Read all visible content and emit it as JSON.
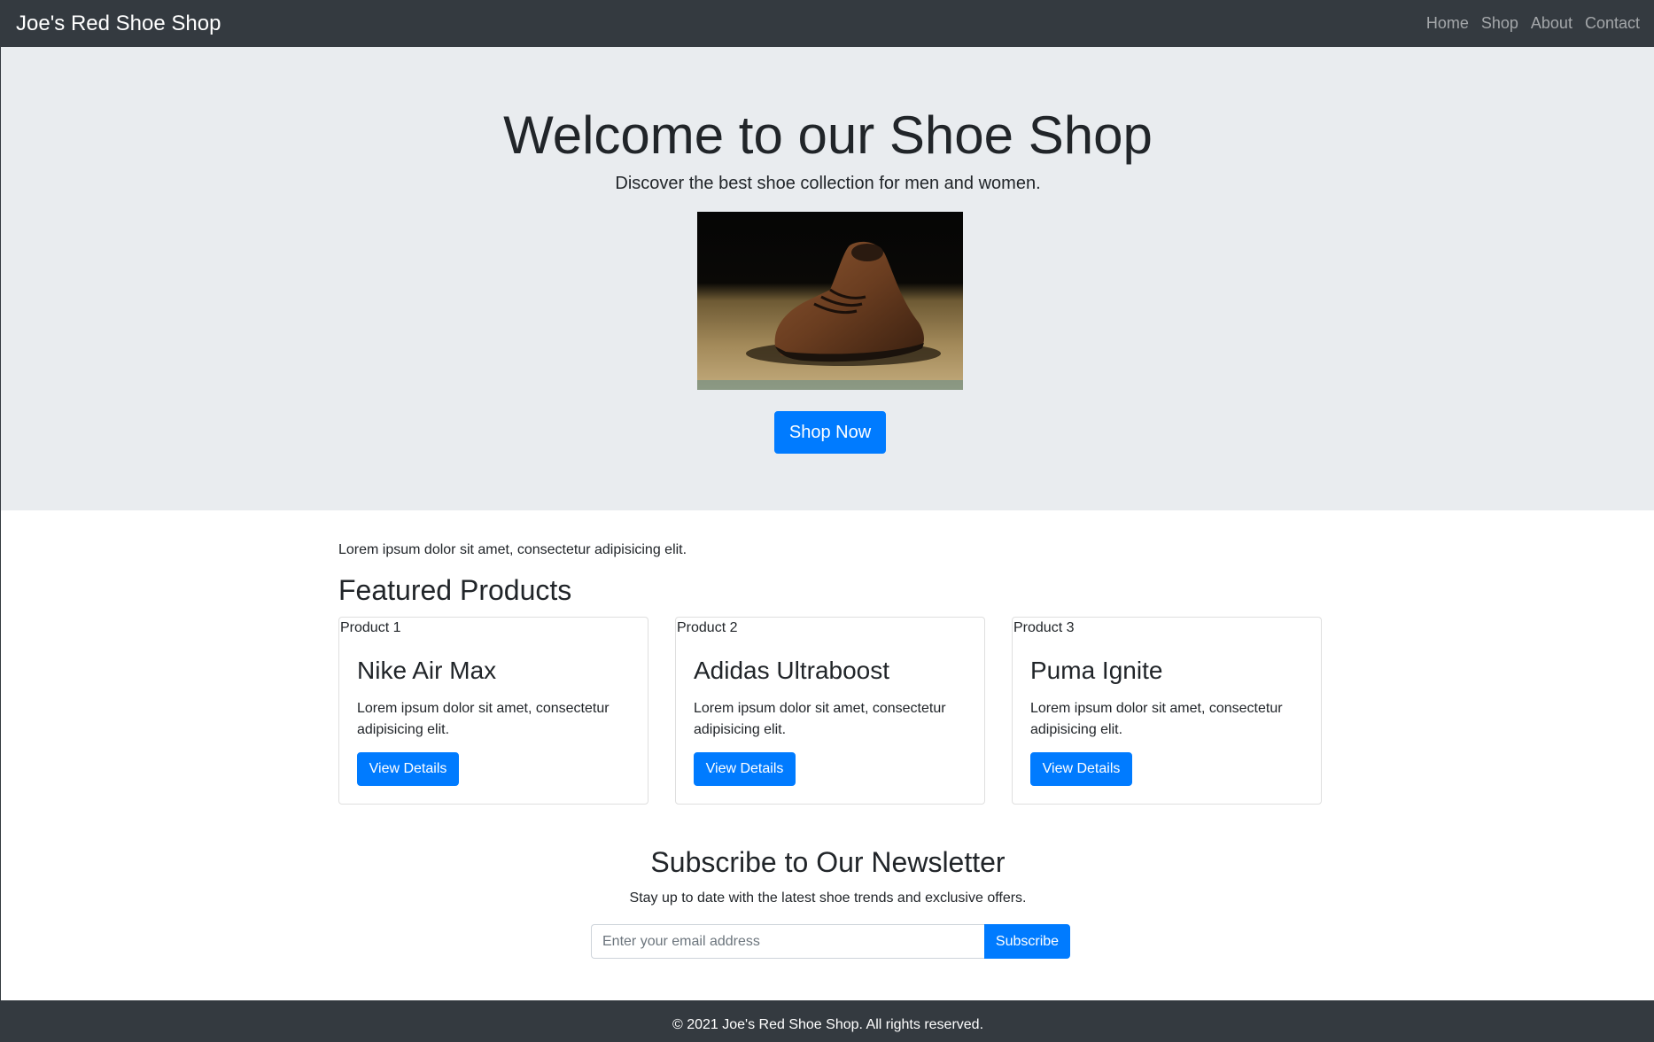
{
  "navbar": {
    "brand": "Joe's Red Shoe Shop",
    "links": [
      "Home",
      "Shop",
      "About",
      "Contact"
    ]
  },
  "hero": {
    "title": "Welcome to our Shoe Shop",
    "lead": "Discover the best shoe collection for men and women.",
    "cta_label": "Shop Now"
  },
  "main": {
    "intro": "Lorem ipsum dolor sit amet, consectetur adipisicing elit.",
    "featured_title": "Featured Products",
    "products": [
      {
        "alt": "Product 1",
        "name": "Nike Air Max",
        "description": "Lorem ipsum dolor sit amet, consectetur adipisicing elit.",
        "button": "View Details"
      },
      {
        "alt": "Product 2",
        "name": "Adidas Ultraboost",
        "description": "Lorem ipsum dolor sit amet, consectetur adipisicing elit.",
        "button": "View Details"
      },
      {
        "alt": "Product 3",
        "name": "Puma Ignite",
        "description": "Lorem ipsum dolor sit amet, consectetur adipisicing elit.",
        "button": "View Details"
      }
    ]
  },
  "newsletter": {
    "title": "Subscribe to Our Newsletter",
    "text": "Stay up to date with the latest shoe trends and exclusive offers.",
    "email_placeholder": "Enter your email address",
    "button": "Subscribe"
  },
  "footer": {
    "text": "© 2021 Joe's Red Shoe Shop. All rights reserved."
  },
  "colors": {
    "navbar_bg": "#343a40",
    "hero_bg": "#e9ecef",
    "primary": "#007bff",
    "text": "#212529"
  }
}
